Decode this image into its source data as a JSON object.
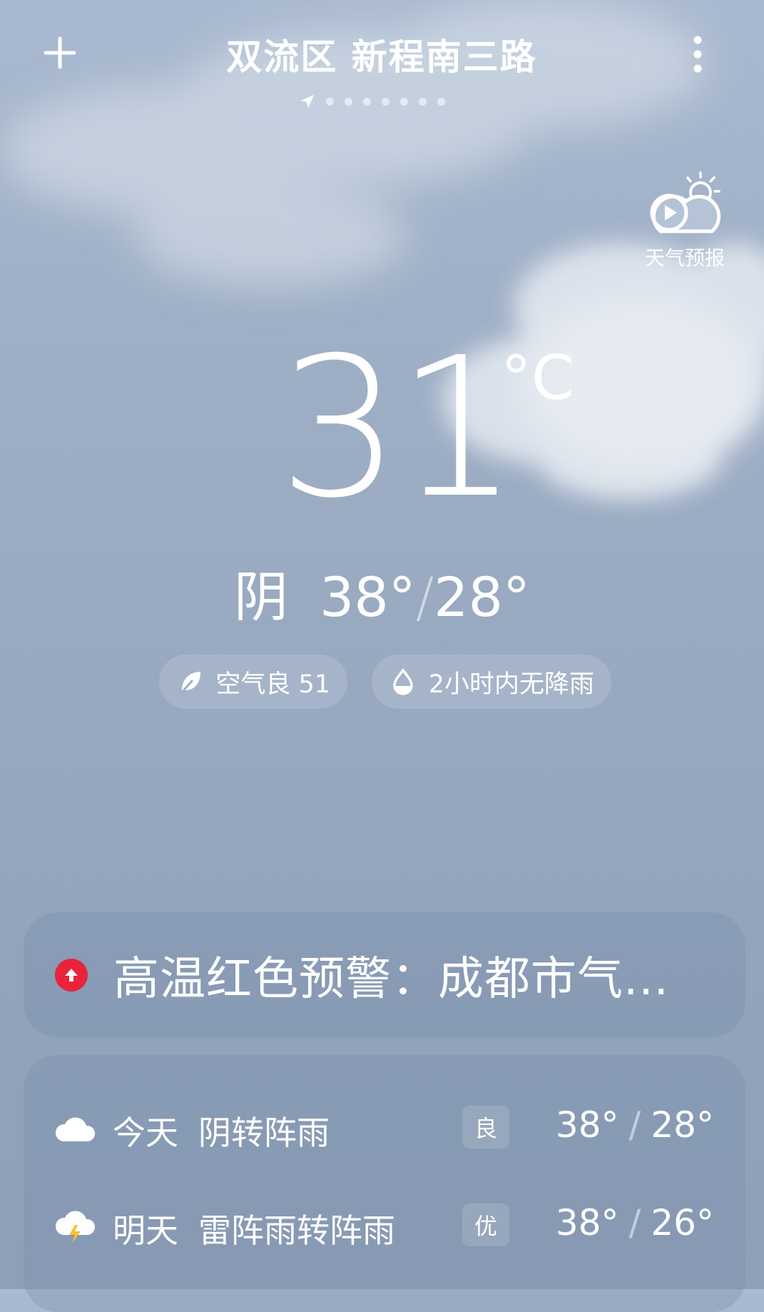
{
  "header": {
    "location": "双流区 新程南三路",
    "add_icon": "plus-icon",
    "menu_icon": "more-vertical-icon",
    "page_count": 7
  },
  "forecast_video": {
    "label": "天气预报",
    "icon": "play-cloud-sun-icon"
  },
  "current": {
    "temperature": "31",
    "unit": "°C",
    "condition": "阴",
    "high": "38°",
    "low": "28°"
  },
  "chips": {
    "air_quality": "空气良 51",
    "rain": "2小时内无降雨"
  },
  "warning": {
    "text": "高温红色预警：成都市气...",
    "color": "#e8233a"
  },
  "daily": [
    {
      "day": "今天",
      "condition": "阴转阵雨",
      "aqi": "良",
      "high": "38°",
      "low": "28°",
      "icon": "cloud-icon"
    },
    {
      "day": "明天",
      "condition": "雷阵雨转阵雨",
      "aqi": "优",
      "high": "38°",
      "low": "26°",
      "icon": "thunderstorm-icon"
    }
  ]
}
